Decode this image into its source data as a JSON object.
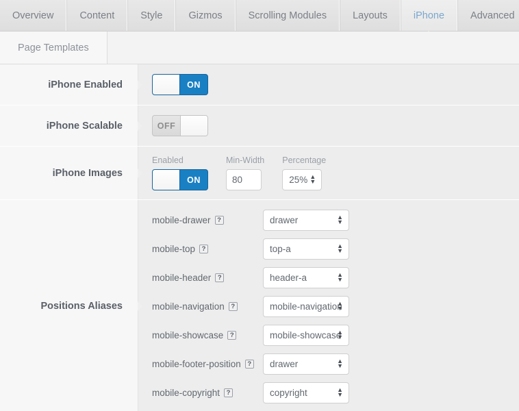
{
  "tabs": [
    {
      "label": "Overview",
      "active": false
    },
    {
      "label": "Content",
      "active": false
    },
    {
      "label": "Style",
      "active": false
    },
    {
      "label": "Gizmos",
      "active": false
    },
    {
      "label": "Scrolling Modules",
      "active": false
    },
    {
      "label": "Layouts",
      "active": false
    },
    {
      "label": "iPhone",
      "active": true
    },
    {
      "label": "Advanced",
      "active": false
    }
  ],
  "subtabs": [
    {
      "label": "Page Templates",
      "active": true
    }
  ],
  "settings": {
    "iphone_enabled": {
      "label": "iPhone Enabled",
      "toggle_state": "ON",
      "toggle_on": true
    },
    "iphone_scalable": {
      "label": "iPhone Scalable",
      "toggle_state": "OFF",
      "toggle_on": false
    },
    "iphone_images": {
      "label": "iPhone Images",
      "enabled_caption": "Enabled",
      "enabled_state": "ON",
      "minwidth_caption": "Min-Width",
      "minwidth_value": "80",
      "percentage_caption": "Percentage",
      "percentage_value": "25%"
    },
    "positions_aliases": {
      "label": "Positions Aliases",
      "help_glyph": "?",
      "items": [
        {
          "name": "mobile-drawer",
          "value": "drawer"
        },
        {
          "name": "mobile-top",
          "value": "top-a"
        },
        {
          "name": "mobile-header",
          "value": "header-a"
        },
        {
          "name": "mobile-navigation",
          "value": "mobile-navigation"
        },
        {
          "name": "mobile-showcase",
          "value": "mobile-showcase"
        },
        {
          "name": "mobile-footer-position",
          "value": "drawer"
        },
        {
          "name": "mobile-copyright",
          "value": "copyright"
        }
      ]
    }
  },
  "colors": {
    "accent_blue": "#1a80c4",
    "accent_blue_border": "#15639b",
    "active_tab_text": "#7ba7cd",
    "panel_bg": "#ededed",
    "label_bg": "#f7f7f7"
  },
  "icons": {
    "stepper": "▲▼"
  }
}
